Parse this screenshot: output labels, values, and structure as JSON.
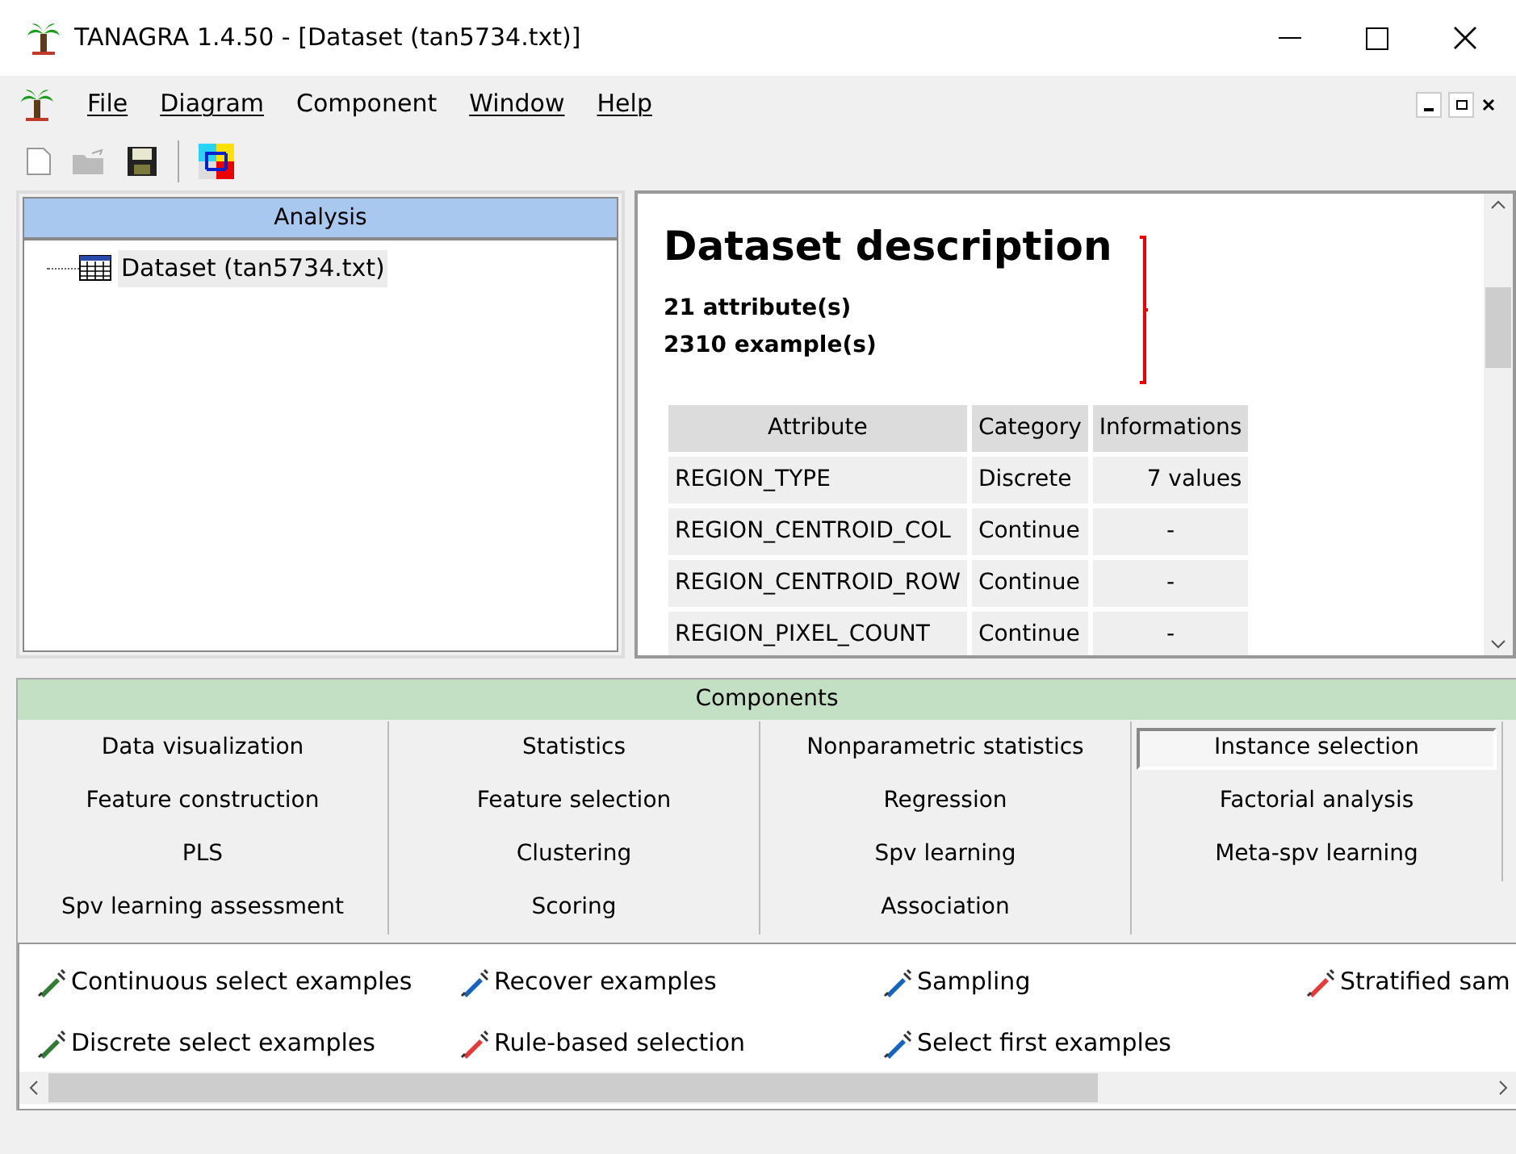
{
  "window": {
    "title": "TANAGRA 1.4.50 - [Dataset (tan5734.txt)]"
  },
  "menu": [
    {
      "label": "File",
      "mnemonic": true
    },
    {
      "label": "Diagram",
      "mnemonic": true
    },
    {
      "label": "Component",
      "mnemonic": false
    },
    {
      "label": "Window",
      "mnemonic": true
    },
    {
      "label": "Help",
      "mnemonic": true
    }
  ],
  "analysis": {
    "title": "Analysis",
    "items": [
      {
        "label": "Dataset (tan5734.txt)",
        "selected": true
      }
    ]
  },
  "description": {
    "title": "Dataset description",
    "lines": [
      "21 attribute(s)",
      "2310 example(s)"
    ],
    "table": {
      "columns": [
        "Attribute",
        "Category",
        "Informations"
      ],
      "rows": [
        [
          "REGION_TYPE",
          "Discrete",
          "7 values"
        ],
        [
          "REGION_CENTROID_COL",
          "Continue",
          "-"
        ],
        [
          "REGION_CENTROID_ROW",
          "Continue",
          "-"
        ],
        [
          "REGION_PIXEL_COUNT",
          "Continue",
          "-"
        ]
      ]
    }
  },
  "components": {
    "title": "Components",
    "tabs": [
      {
        "label": "Data visualization",
        "selected": false
      },
      {
        "label": "Statistics",
        "selected": false
      },
      {
        "label": "Nonparametric statistics",
        "selected": false
      },
      {
        "label": "Instance selection",
        "selected": true
      },
      {
        "label": "Feature construction",
        "selected": false
      },
      {
        "label": "Feature selection",
        "selected": false
      },
      {
        "label": "Regression",
        "selected": false
      },
      {
        "label": "Factorial analysis",
        "selected": false
      },
      {
        "label": "PLS",
        "selected": false
      },
      {
        "label": "Clustering",
        "selected": false
      },
      {
        "label": "Spv learning",
        "selected": false
      },
      {
        "label": "Meta-spv learning",
        "selected": false
      },
      {
        "label": "Spv learning assessment",
        "selected": false
      },
      {
        "label": "Scoring",
        "selected": false
      },
      {
        "label": "Association",
        "selected": false
      }
    ],
    "items": [
      {
        "label": "Continuous select examples",
        "color": "#2e7d32"
      },
      {
        "label": "Recover examples",
        "color": "#1565c0"
      },
      {
        "label": "Sampling",
        "color": "#1565c0"
      },
      {
        "label": "Stratified sam",
        "color": "#e53935"
      },
      {
        "label": "Discrete select examples",
        "color": "#2e7d32"
      },
      {
        "label": "Rule-based selection",
        "color": "#e53935"
      },
      {
        "label": "Select first examples",
        "color": "#1565c0"
      }
    ]
  }
}
